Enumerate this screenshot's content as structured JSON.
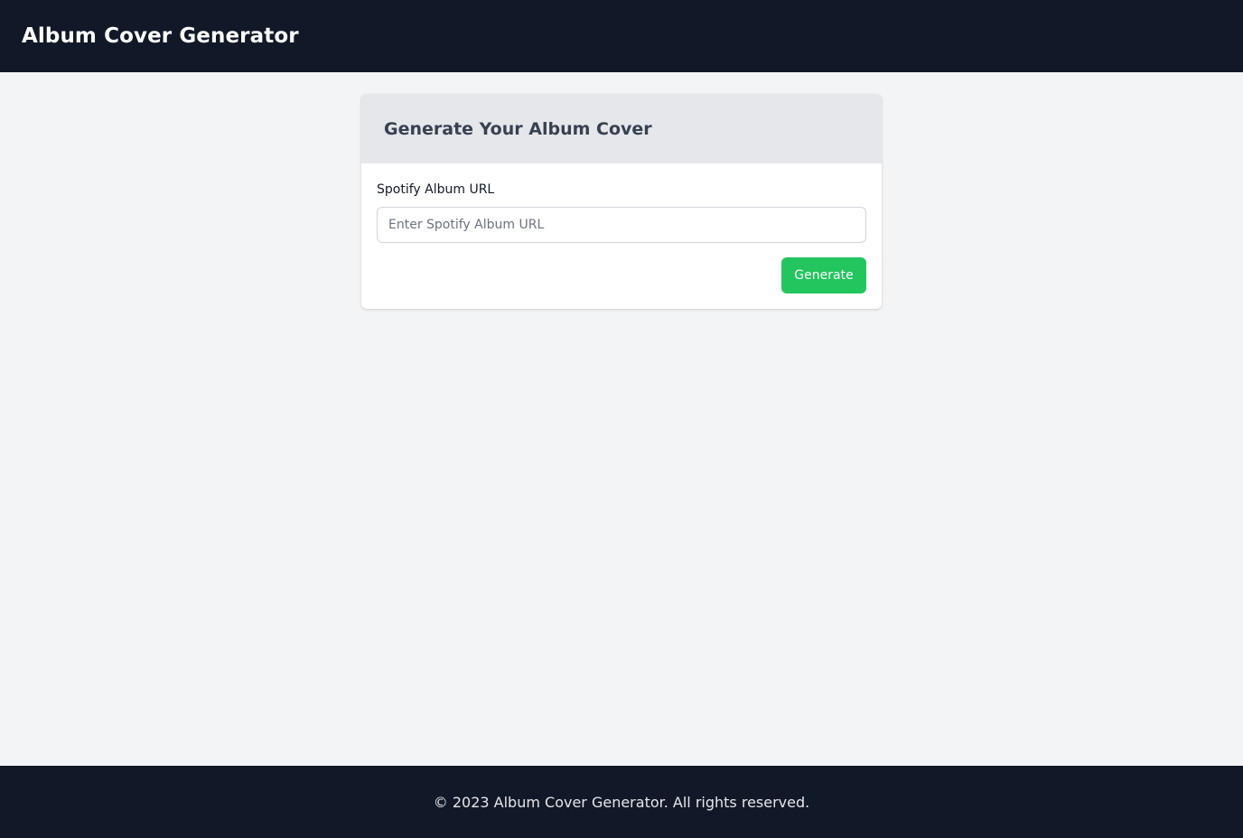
{
  "header": {
    "title": "Album Cover Generator"
  },
  "card": {
    "title": "Generate Your Album Cover",
    "url_label": "Spotify Album URL",
    "url_value": "",
    "url_placeholder": "Enter Spotify Album URL",
    "generate_label": "Generate"
  },
  "footer": {
    "text": "© 2023 Album Cover Generator. All rights reserved."
  },
  "colors": {
    "topbar": "#111827",
    "page_background": "#f3f4f6",
    "card_header": "#e5e7eb",
    "accent_button": "#22c55e"
  }
}
